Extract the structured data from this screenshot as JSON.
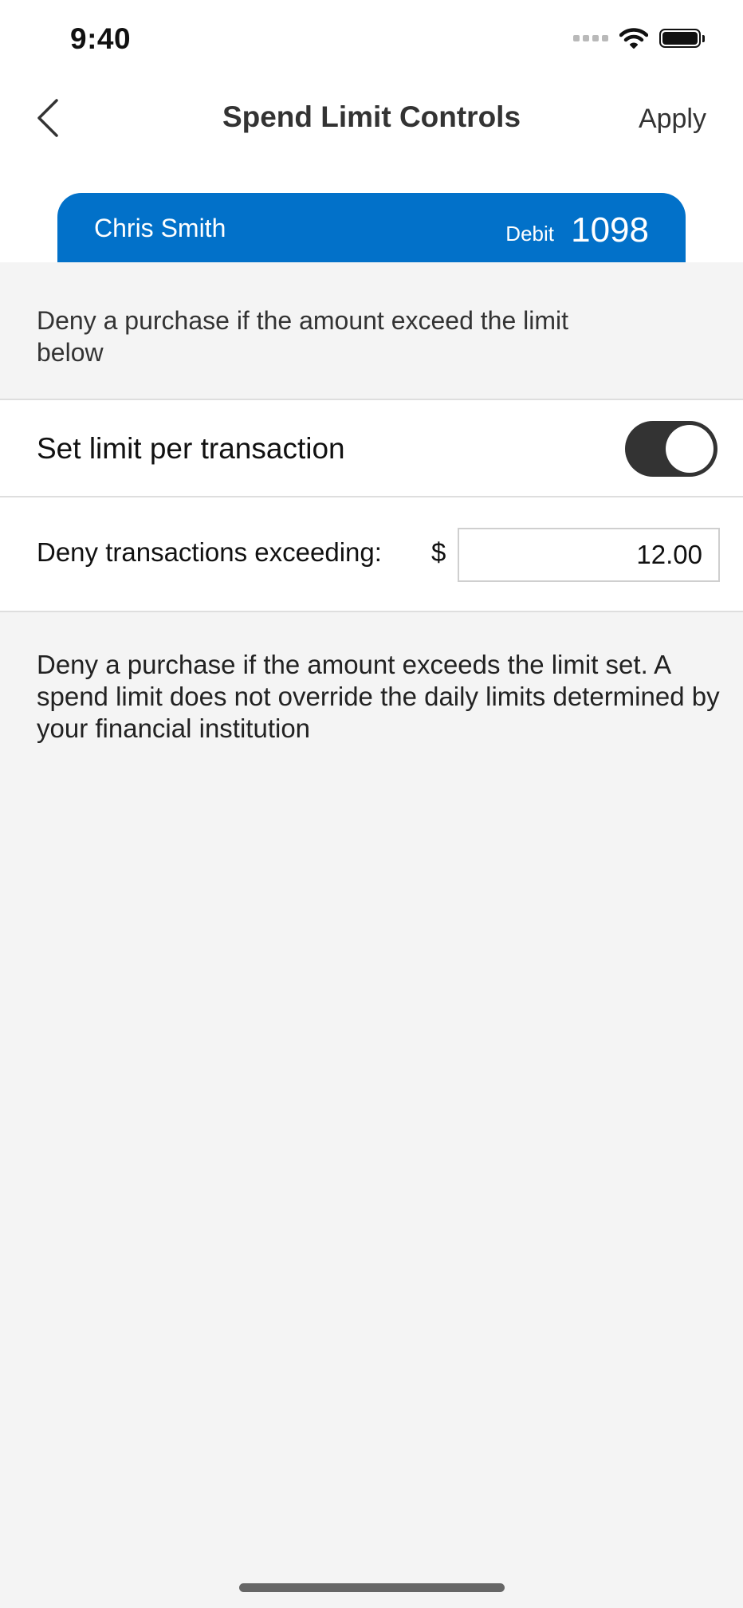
{
  "status_bar": {
    "time": "9:40",
    "icons": [
      "signal-icon",
      "wifi-icon",
      "battery-icon"
    ]
  },
  "header": {
    "title": "Spend Limit Controls",
    "apply_label": "Apply",
    "back_icon": "chevron-left-icon"
  },
  "card": {
    "holder": "Chris Smith",
    "type": "Debit",
    "number": "1098",
    "color": "#0271c9"
  },
  "intro": {
    "text": "Deny a purchase if the amount exceed the limit below"
  },
  "limit_toggle": {
    "label": "Set limit per transaction",
    "enabled": true
  },
  "limit_amount": {
    "label": "Deny transactions exceeding:",
    "currency": "$",
    "value": "12.00"
  },
  "info": {
    "text": "Deny a purchase if the amount exceeds the limit set. A spend limit does not override the daily limits determined by your financial institution"
  }
}
